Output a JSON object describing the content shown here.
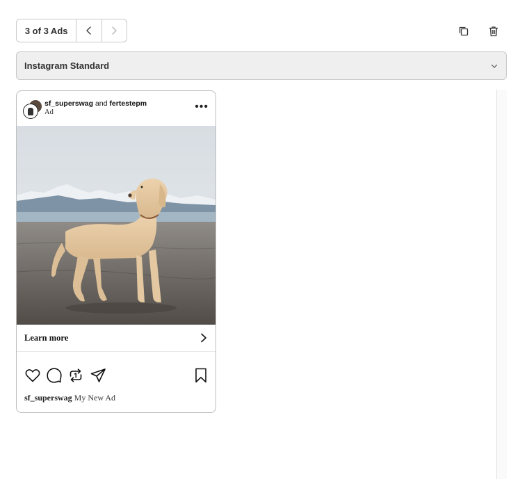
{
  "toolbar": {
    "ad_counter": "3 of 3 Ads",
    "prev_icon": "chevron-left-icon",
    "next_icon": "chevron-right-icon",
    "duplicate_icon": "copy-icon",
    "delete_icon": "trash-icon"
  },
  "placement": {
    "selected": "Instagram Standard",
    "icon": "chevron-down-icon"
  },
  "ad_preview": {
    "account_primary": "sf_superswag",
    "and_word": "and",
    "account_secondary": "fertestepm",
    "sponsored_label": "Ad",
    "more_icon": "more-horizontal-icon",
    "more_symbol": "•••",
    "image_subject": "dog-photo",
    "cta_label": "Learn more",
    "cta_icon": "chevron-right-icon",
    "actions": [
      "heart-icon",
      "comment-icon",
      "repost-icon",
      "share-icon",
      "bookmark-icon"
    ],
    "caption_account": "sf_superswag",
    "caption_text": "My New Ad"
  }
}
